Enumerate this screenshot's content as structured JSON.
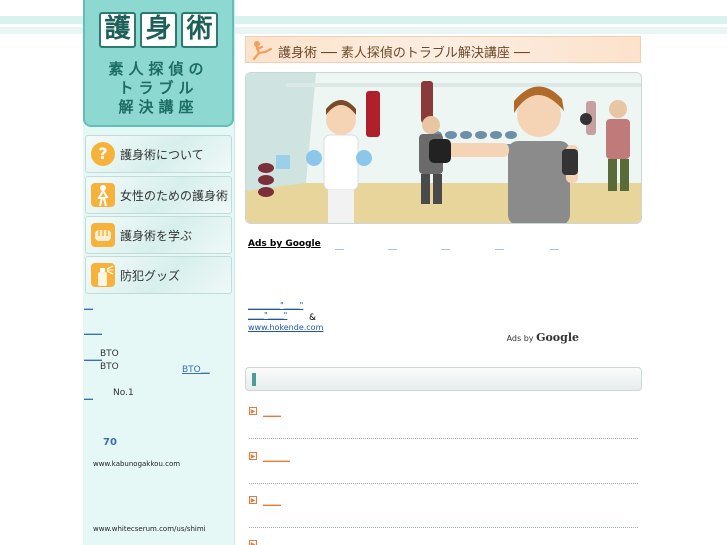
{
  "logo": {
    "kanji": [
      "護",
      "身",
      "術"
    ],
    "sub_line1": "素人探偵の",
    "sub_line2": "トラブル",
    "sub_line3": "解決講座"
  },
  "nav": [
    {
      "label": "護身術について",
      "icon": "question-icon"
    },
    {
      "label": "女性のための護身術",
      "icon": "woman-figure-icon"
    },
    {
      "label": "護身術を学ぶ",
      "icon": "fist-icon"
    },
    {
      "label": "防犯グッズ",
      "icon": "spray-icon"
    }
  ],
  "sidebar": {
    "link1": "＿",
    "link2": "＿＿",
    "link3": "＿＿",
    "bto1": "BTO",
    "bto2": "BTO",
    "bto_link": "BTO＿",
    "link4": "＿",
    "no1": "No.1",
    "num70": "70",
    "url1": "www.kabunogakkou.com",
    "url2": "www.whitecserum.com/us/shimi"
  },
  "header": {
    "title": "護身術 ── 素人探偵のトラブル解決講座 ──"
  },
  "ads": {
    "title": "Ads by Google",
    "dashes": [
      "＿",
      "＿",
      "＿",
      "＿",
      "＿"
    ],
    "ad_link1": "＿＿＿＿\"＿＿\"",
    "ad_link2": "＿＿\"＿＿\"",
    "amp": "&",
    "ad_url": "www.hokende.com",
    "ads_by": "Ads by",
    "google": "Google"
  },
  "list": [
    {
      "label": "＿＿"
    },
    {
      "label": "＿＿＿"
    },
    {
      "label": "＿＿"
    },
    {
      "label": ""
    }
  ],
  "colors": {
    "accent": "#8dd9d1",
    "link": "#2255aa",
    "orange": "#e47a3b"
  }
}
